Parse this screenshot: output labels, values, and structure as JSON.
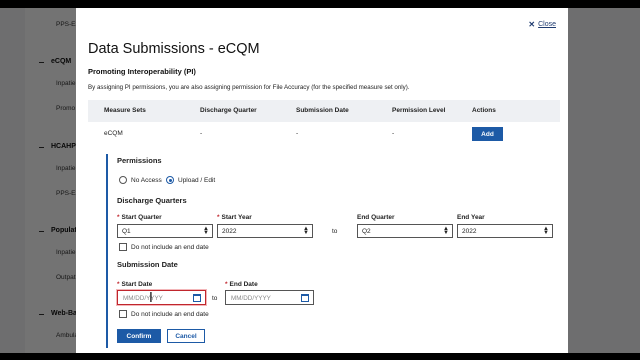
{
  "background": {
    "items": [
      {
        "text": "PPS-Ex",
        "head": false
      },
      {
        "text": "eCQM",
        "head": true
      },
      {
        "text": "Inpatie",
        "head": false
      },
      {
        "text": "Promo",
        "head": false
      },
      {
        "text": "HCAHPS",
        "head": true
      },
      {
        "text": "Inpatie",
        "head": false
      },
      {
        "text": "PPS-Ex",
        "head": false
      },
      {
        "text": "Populati",
        "head": true
      },
      {
        "text": "Inpatie",
        "head": false
      },
      {
        "text": "Outpat",
        "head": false
      },
      {
        "text": "Web-Ba",
        "head": true
      },
      {
        "text": "Ambula",
        "head": false
      }
    ]
  },
  "modal": {
    "close_label": "Close",
    "title": "Data Submissions - eCQM",
    "subtitle": "Promoting Interoperability (PI)",
    "description": "By assigning PI permissions, you are also assigning permission for File Accuracy (for the specified measure set only).",
    "table": {
      "headers": [
        "Measure Sets",
        "Discharge Quarter",
        "Submission Date",
        "Permission Level",
        "Actions"
      ],
      "row": {
        "measure_set": "eCQM",
        "discharge_quarter": "-",
        "submission_date": "-",
        "permission_level": "-",
        "action_label": "Add"
      }
    },
    "permissions": {
      "heading": "Permissions",
      "options": [
        {
          "label": "No Access",
          "selected": false
        },
        {
          "label": "Upload / Edit",
          "selected": true
        }
      ]
    },
    "discharge": {
      "heading": "Discharge Quarters",
      "start_quarter_label": "Start Quarter",
      "start_quarter_value": "Q1",
      "start_year_label": "Start Year",
      "start_year_value": "2022",
      "to_label": "to",
      "end_quarter_label": "End Quarter",
      "end_quarter_value": "Q2",
      "end_year_label": "End Year",
      "end_year_value": "2022",
      "no_end_label": "Do not include an end date"
    },
    "submission": {
      "heading": "Submission Date",
      "start_label": "Start Date",
      "start_placeholder": "MM/DD/YYYY",
      "to_label": "to",
      "end_label": "End Date",
      "end_placeholder": "MM/DD/YYYY",
      "no_end_label": "Do not include an end date"
    },
    "confirm_label": "Confirm",
    "cancel_label": "Cancel"
  },
  "colors": {
    "accent": "#1d5aa6",
    "required": "#c0262d"
  }
}
